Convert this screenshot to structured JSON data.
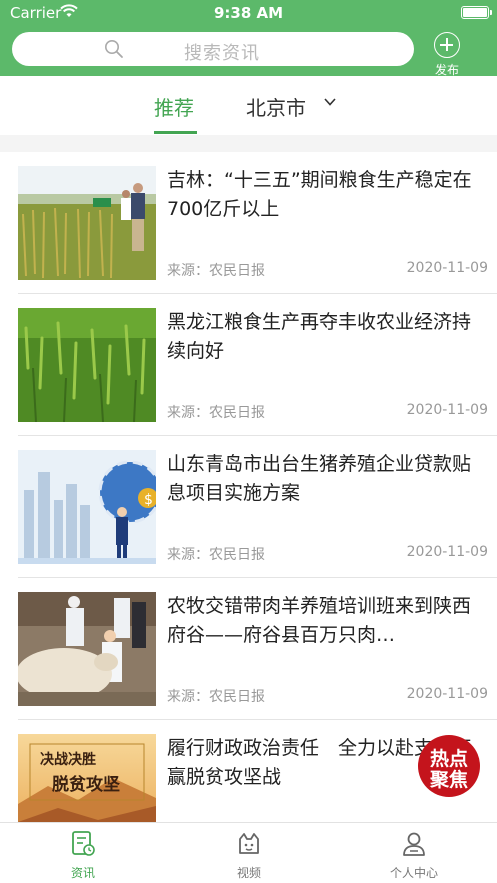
{
  "status_bar": {
    "carrier": "Carrier",
    "time": "9:38 AM"
  },
  "header": {
    "search_placeholder": "搜索资讯",
    "publish_label": "发布"
  },
  "tabs": {
    "recommended": "推荐",
    "city": "北京市"
  },
  "news": [
    {
      "title": "吉林：“十三五”期间粮食生产稳定在700亿斤以上",
      "source": "来源：农民日报",
      "date": "2020-11-09",
      "image": "rice-field-visitors"
    },
    {
      "title": "黑龙江粮食生产再夺丰收农业经济持续向好",
      "source": "来源：农民日报",
      "date": "2020-11-09",
      "image": "wheat-field"
    },
    {
      "title": "山东青岛市出台生猪养殖企业贷款贴息项目实施方案",
      "source": "来源：农民日报",
      "date": "2020-11-09",
      "image": "business-globe-city"
    },
    {
      "title": "农牧交错带肉羊养殖培训班来到陕西府谷——府谷县百万只肉…",
      "source": "来源：农民日报",
      "date": "2020-11-09",
      "image": "sheep-training"
    },
    {
      "title": "履行财政政治责任　全力以赴支持打赢脱贫攻坚战",
      "source": "",
      "date": "",
      "image": "poverty-alleviation-banner",
      "image_text_1": "决战决胜",
      "image_text_2": "脱贫攻坚"
    }
  ],
  "hotspot_badge": {
    "line1": "热点",
    "line2": "聚焦"
  },
  "tabbar": [
    {
      "label": "资讯",
      "icon": "news-icon",
      "active": true
    },
    {
      "label": "视频",
      "icon": "video-icon",
      "active": false
    },
    {
      "label": "个人中心",
      "icon": "profile-icon",
      "active": false
    }
  ],
  "colors": {
    "brand_green": "#5cb96a",
    "accent_green": "#43a552",
    "hotspot_red": "#c4141c"
  }
}
